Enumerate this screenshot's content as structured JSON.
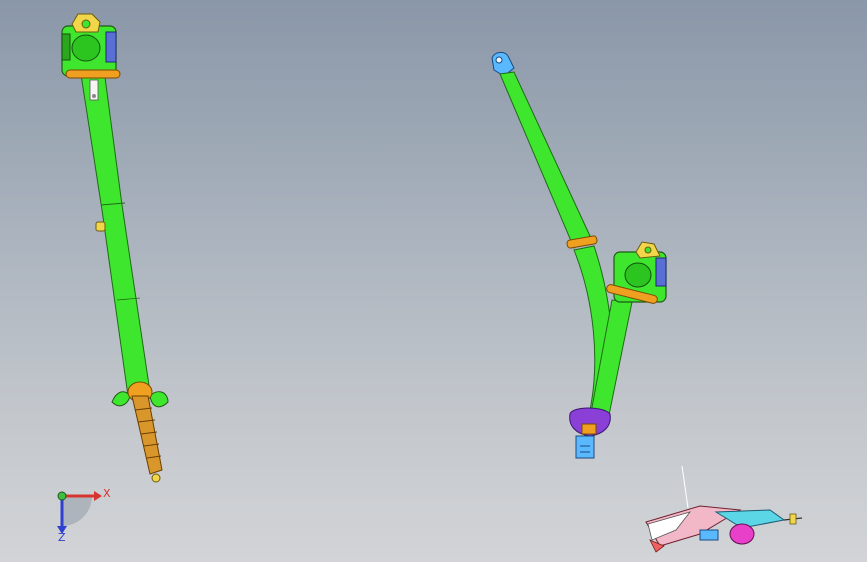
{
  "viewport": {
    "background_top": "#8a97a8",
    "background_bottom": "#d2d4d7"
  },
  "model": {
    "webbing_color": "#3fe62e",
    "retractor_color": "#3fe62e",
    "guide_color": "#f0a020",
    "anchor_color": "#f2d64a",
    "buckle_color": "#8a3fd6",
    "tongue_color": "#5ab8ff"
  },
  "triad": {
    "x_label": "X",
    "z_label": "Z",
    "x_color": "#d8342f",
    "y_color": "#3fbf3f",
    "z_color": "#2f3fd0"
  }
}
